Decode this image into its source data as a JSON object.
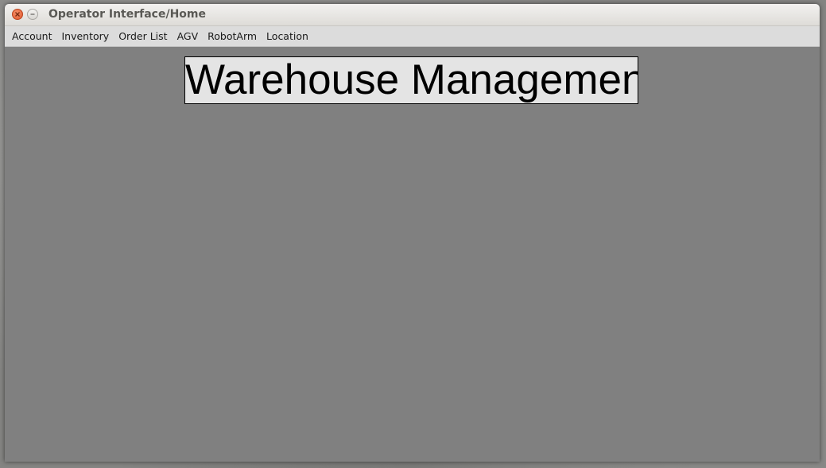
{
  "window": {
    "title": "Operator Interface/Home"
  },
  "menubar": {
    "items": [
      {
        "label": "Account"
      },
      {
        "label": "Inventory"
      },
      {
        "label": "Order List"
      },
      {
        "label": "AGV"
      },
      {
        "label": "RobotArm"
      },
      {
        "label": "Location"
      }
    ]
  },
  "main": {
    "heading": "Warehouse Management"
  },
  "colors": {
    "content_background": "#808080",
    "close_button": "#e0562b",
    "heading_background": "#e4e4e4"
  },
  "icons": {
    "close": "close-icon",
    "minimize": "minimize-icon"
  }
}
